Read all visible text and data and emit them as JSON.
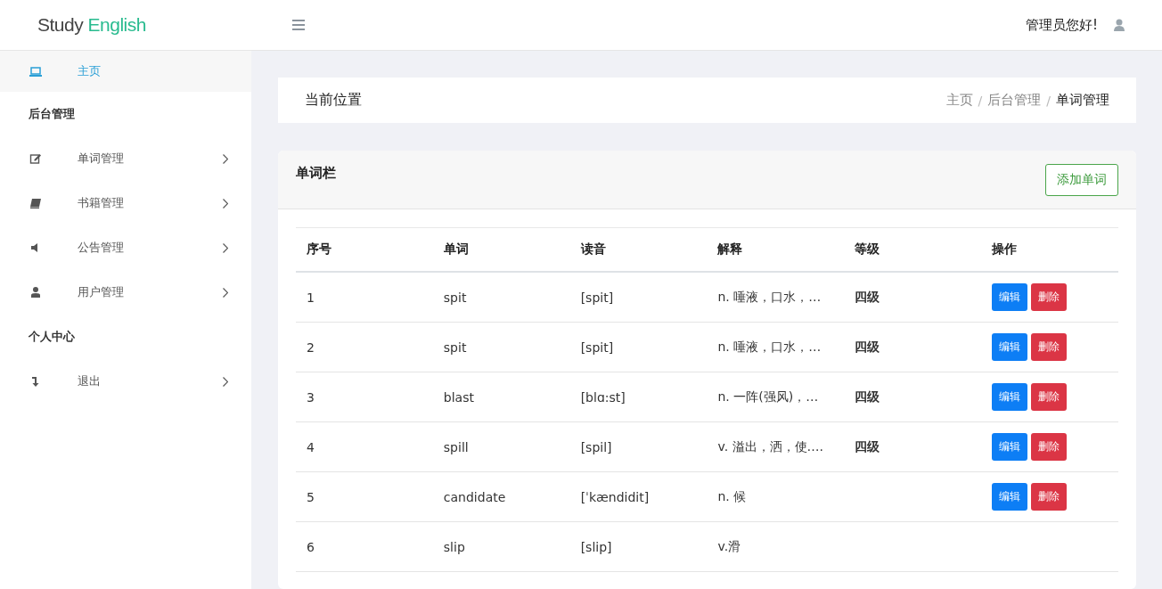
{
  "header": {
    "logo": [
      "Study",
      "English"
    ],
    "greeting": "管理员您好!"
  },
  "sidebar": {
    "items": [
      {
        "kind": "link",
        "label": "主页",
        "selected": true
      },
      {
        "kind": "section",
        "label": "后台管理"
      },
      {
        "kind": "link",
        "label": "单词管理",
        "selected": false,
        "chevron": true
      },
      {
        "kind": "link",
        "label": "书籍管理",
        "selected": false,
        "chevron": true
      },
      {
        "kind": "link",
        "label": "公告管理",
        "selected": false,
        "chevron": true
      },
      {
        "kind": "link",
        "label": "用户管理",
        "selected": false,
        "chevron": true
      },
      {
        "kind": "section",
        "label": "个人中心"
      },
      {
        "kind": "link",
        "label": "退出",
        "selected": false,
        "chevron": true
      }
    ]
  },
  "breadcrumb": {
    "title": "当前位置",
    "separator": "/",
    "path": [
      "主页",
      "后台管理",
      "单词管理"
    ]
  },
  "card": {
    "title": "单词栏",
    "add_button": "添加单词",
    "table": {
      "columns": [
        "序号",
        "单词",
        "读音",
        "解释",
        "等级",
        "操作"
      ],
      "rows": [
        {
          "cells": [
            "1",
            "spit",
            "[spit]",
            "n. 唾液，口水，…",
            "四级"
          ],
          "buttons": [
            "编辑",
            "删除"
          ]
        },
        {
          "cells": [
            "2",
            "spit",
            "[spit]",
            "n. 唾液，口水，…",
            "四级"
          ],
          "buttons": [
            "编辑",
            "删除"
          ]
        },
        {
          "cells": [
            "3",
            "blast",
            "[blɑ:st]",
            "n. 一阵(强风)，…",
            "四级"
          ],
          "buttons": [
            "编辑",
            "删除"
          ]
        },
        {
          "cells": [
            "4",
            "spill",
            "[spil]",
            "v. 溢出，洒，使….",
            "四级"
          ],
          "buttons": [
            "编辑",
            "删除"
          ]
        },
        {
          "cells": [
            "5",
            "candidate",
            "[ˈkændidit]",
            "n. 候"
          ],
          "buttons": [
            "编辑",
            "删除"
          ]
        },
        {
          "cells": [
            "6",
            "slip",
            "[slip]",
            "v.滑"
          ]
        }
      ]
    }
  }
}
